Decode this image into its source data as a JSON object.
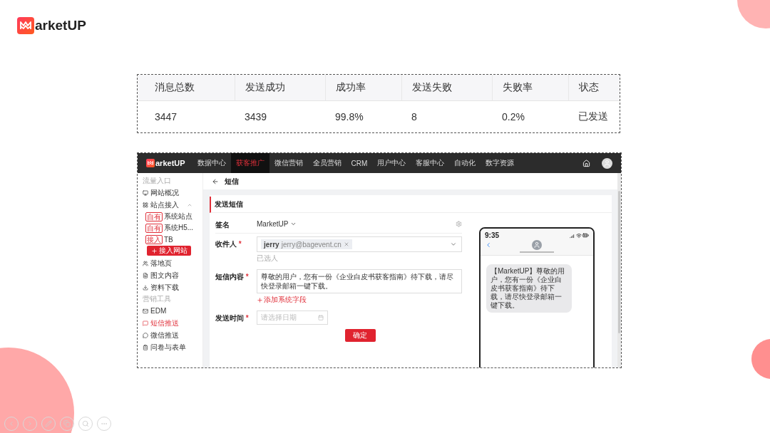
{
  "brand": {
    "name": "arketUP"
  },
  "stats_table": {
    "columns": [
      "消息总数",
      "发送成功",
      "成功率",
      "发送失败",
      "失败率",
      "状态"
    ],
    "rows": [
      [
        "3447",
        "3439",
        "99.8%",
        "8",
        "0.2%",
        "已发送"
      ]
    ]
  },
  "app": {
    "brand": "arketUP",
    "nav": [
      {
        "label": "数据中心",
        "selected": false
      },
      {
        "label": "获客推广",
        "selected": true
      },
      {
        "label": "微信营销",
        "selected": false
      },
      {
        "label": "全员营销",
        "selected": false
      },
      {
        "label": "CRM",
        "selected": false
      },
      {
        "label": "用户中心",
        "selected": false
      },
      {
        "label": "客服中心",
        "selected": false
      },
      {
        "label": "自动化",
        "selected": false
      },
      {
        "label": "数字资源",
        "selected": false
      }
    ],
    "sidebar": [
      {
        "title": "流量入口",
        "items": [
          {
            "label": "网站概况",
            "selected": false
          },
          {
            "label": "站点接入",
            "selected": false,
            "expanded": true,
            "children": [
              {
                "tag": "自有",
                "label": "系统站点"
              },
              {
                "tag": "自有",
                "label": "系统H5..."
              },
              {
                "tag": "接入",
                "label": "TB"
              }
            ],
            "action": "接入网站"
          },
          {
            "label": "落地页",
            "selected": false
          },
          {
            "label": "图文内容",
            "selected": false
          },
          {
            "label": "资料下载",
            "selected": false
          }
        ]
      },
      {
        "title": "营销工具",
        "items": [
          {
            "label": "EDM",
            "selected": false
          },
          {
            "label": "短信推送",
            "selected": true
          },
          {
            "label": "微信推送",
            "selected": false
          },
          {
            "label": "问卷与表单",
            "selected": false
          }
        ]
      }
    ],
    "page_title": "短信",
    "card_title": "发送短信",
    "fields": [
      {
        "kind": "select",
        "label": "签名",
        "required": false,
        "value": "MarketUP"
      },
      {
        "kind": "recipients",
        "label": "收件人",
        "required": true,
        "chips": [
          {
            "name": "jerry",
            "email": "jerry@bagevent.cn"
          }
        ],
        "hint": "已选人"
      },
      {
        "kind": "textarea",
        "label": "短信内容",
        "required": true,
        "value": "尊敬的用户，您有一份《企业白皮书获客指南》待下载，请尽快登录邮箱一键下载。",
        "link": "添加系统字段"
      },
      {
        "kind": "date",
        "label": "发送时间",
        "required": true,
        "placeholder": "请选择日期"
      }
    ],
    "required_mark": "*",
    "submit": "确定",
    "phone": {
      "time": "9:35",
      "message": "【MarketUP】尊敬的用户，您有一份《企业白皮书获客指南》待下载，请尽快登录邮箱一键下载。"
    }
  }
}
